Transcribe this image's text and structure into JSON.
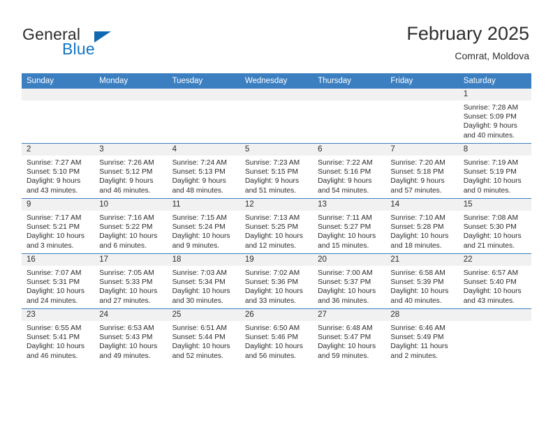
{
  "brand": {
    "word_one": "General",
    "word_two": "Blue",
    "accent_color": "#1275c4",
    "triangle_color": "#1269b0"
  },
  "header": {
    "title": "February 2025",
    "location": "Comrat, Moldova"
  },
  "theme": {
    "header_row_bg": "#3c7fc1",
    "daynum_band_bg": "#f1f1f1",
    "grid_line": "#3c7fc1"
  },
  "calendar": {
    "weekday_headers": [
      "Sunday",
      "Monday",
      "Tuesday",
      "Wednesday",
      "Thursday",
      "Friday",
      "Saturday"
    ],
    "weeks": [
      [
        {
          "day": "",
          "sunrise": "",
          "sunset": "",
          "daylight_line1": "",
          "daylight_line2": ""
        },
        {
          "day": "",
          "sunrise": "",
          "sunset": "",
          "daylight_line1": "",
          "daylight_line2": ""
        },
        {
          "day": "",
          "sunrise": "",
          "sunset": "",
          "daylight_line1": "",
          "daylight_line2": ""
        },
        {
          "day": "",
          "sunrise": "",
          "sunset": "",
          "daylight_line1": "",
          "daylight_line2": ""
        },
        {
          "day": "",
          "sunrise": "",
          "sunset": "",
          "daylight_line1": "",
          "daylight_line2": ""
        },
        {
          "day": "",
          "sunrise": "",
          "sunset": "",
          "daylight_line1": "",
          "daylight_line2": ""
        },
        {
          "day": "1",
          "sunrise": "Sunrise: 7:28 AM",
          "sunset": "Sunset: 5:09 PM",
          "daylight_line1": "Daylight: 9 hours",
          "daylight_line2": "and 40 minutes."
        }
      ],
      [
        {
          "day": "2",
          "sunrise": "Sunrise: 7:27 AM",
          "sunset": "Sunset: 5:10 PM",
          "daylight_line1": "Daylight: 9 hours",
          "daylight_line2": "and 43 minutes."
        },
        {
          "day": "3",
          "sunrise": "Sunrise: 7:26 AM",
          "sunset": "Sunset: 5:12 PM",
          "daylight_line1": "Daylight: 9 hours",
          "daylight_line2": "and 46 minutes."
        },
        {
          "day": "4",
          "sunrise": "Sunrise: 7:24 AM",
          "sunset": "Sunset: 5:13 PM",
          "daylight_line1": "Daylight: 9 hours",
          "daylight_line2": "and 48 minutes."
        },
        {
          "day": "5",
          "sunrise": "Sunrise: 7:23 AM",
          "sunset": "Sunset: 5:15 PM",
          "daylight_line1": "Daylight: 9 hours",
          "daylight_line2": "and 51 minutes."
        },
        {
          "day": "6",
          "sunrise": "Sunrise: 7:22 AM",
          "sunset": "Sunset: 5:16 PM",
          "daylight_line1": "Daylight: 9 hours",
          "daylight_line2": "and 54 minutes."
        },
        {
          "day": "7",
          "sunrise": "Sunrise: 7:20 AM",
          "sunset": "Sunset: 5:18 PM",
          "daylight_line1": "Daylight: 9 hours",
          "daylight_line2": "and 57 minutes."
        },
        {
          "day": "8",
          "sunrise": "Sunrise: 7:19 AM",
          "sunset": "Sunset: 5:19 PM",
          "daylight_line1": "Daylight: 10 hours",
          "daylight_line2": "and 0 minutes."
        }
      ],
      [
        {
          "day": "9",
          "sunrise": "Sunrise: 7:17 AM",
          "sunset": "Sunset: 5:21 PM",
          "daylight_line1": "Daylight: 10 hours",
          "daylight_line2": "and 3 minutes."
        },
        {
          "day": "10",
          "sunrise": "Sunrise: 7:16 AM",
          "sunset": "Sunset: 5:22 PM",
          "daylight_line1": "Daylight: 10 hours",
          "daylight_line2": "and 6 minutes."
        },
        {
          "day": "11",
          "sunrise": "Sunrise: 7:15 AM",
          "sunset": "Sunset: 5:24 PM",
          "daylight_line1": "Daylight: 10 hours",
          "daylight_line2": "and 9 minutes."
        },
        {
          "day": "12",
          "sunrise": "Sunrise: 7:13 AM",
          "sunset": "Sunset: 5:25 PM",
          "daylight_line1": "Daylight: 10 hours",
          "daylight_line2": "and 12 minutes."
        },
        {
          "day": "13",
          "sunrise": "Sunrise: 7:11 AM",
          "sunset": "Sunset: 5:27 PM",
          "daylight_line1": "Daylight: 10 hours",
          "daylight_line2": "and 15 minutes."
        },
        {
          "day": "14",
          "sunrise": "Sunrise: 7:10 AM",
          "sunset": "Sunset: 5:28 PM",
          "daylight_line1": "Daylight: 10 hours",
          "daylight_line2": "and 18 minutes."
        },
        {
          "day": "15",
          "sunrise": "Sunrise: 7:08 AM",
          "sunset": "Sunset: 5:30 PM",
          "daylight_line1": "Daylight: 10 hours",
          "daylight_line2": "and 21 minutes."
        }
      ],
      [
        {
          "day": "16",
          "sunrise": "Sunrise: 7:07 AM",
          "sunset": "Sunset: 5:31 PM",
          "daylight_line1": "Daylight: 10 hours",
          "daylight_line2": "and 24 minutes."
        },
        {
          "day": "17",
          "sunrise": "Sunrise: 7:05 AM",
          "sunset": "Sunset: 5:33 PM",
          "daylight_line1": "Daylight: 10 hours",
          "daylight_line2": "and 27 minutes."
        },
        {
          "day": "18",
          "sunrise": "Sunrise: 7:03 AM",
          "sunset": "Sunset: 5:34 PM",
          "daylight_line1": "Daylight: 10 hours",
          "daylight_line2": "and 30 minutes."
        },
        {
          "day": "19",
          "sunrise": "Sunrise: 7:02 AM",
          "sunset": "Sunset: 5:36 PM",
          "daylight_line1": "Daylight: 10 hours",
          "daylight_line2": "and 33 minutes."
        },
        {
          "day": "20",
          "sunrise": "Sunrise: 7:00 AM",
          "sunset": "Sunset: 5:37 PM",
          "daylight_line1": "Daylight: 10 hours",
          "daylight_line2": "and 36 minutes."
        },
        {
          "day": "21",
          "sunrise": "Sunrise: 6:58 AM",
          "sunset": "Sunset: 5:39 PM",
          "daylight_line1": "Daylight: 10 hours",
          "daylight_line2": "and 40 minutes."
        },
        {
          "day": "22",
          "sunrise": "Sunrise: 6:57 AM",
          "sunset": "Sunset: 5:40 PM",
          "daylight_line1": "Daylight: 10 hours",
          "daylight_line2": "and 43 minutes."
        }
      ],
      [
        {
          "day": "23",
          "sunrise": "Sunrise: 6:55 AM",
          "sunset": "Sunset: 5:41 PM",
          "daylight_line1": "Daylight: 10 hours",
          "daylight_line2": "and 46 minutes."
        },
        {
          "day": "24",
          "sunrise": "Sunrise: 6:53 AM",
          "sunset": "Sunset: 5:43 PM",
          "daylight_line1": "Daylight: 10 hours",
          "daylight_line2": "and 49 minutes."
        },
        {
          "day": "25",
          "sunrise": "Sunrise: 6:51 AM",
          "sunset": "Sunset: 5:44 PM",
          "daylight_line1": "Daylight: 10 hours",
          "daylight_line2": "and 52 minutes."
        },
        {
          "day": "26",
          "sunrise": "Sunrise: 6:50 AM",
          "sunset": "Sunset: 5:46 PM",
          "daylight_line1": "Daylight: 10 hours",
          "daylight_line2": "and 56 minutes."
        },
        {
          "day": "27",
          "sunrise": "Sunrise: 6:48 AM",
          "sunset": "Sunset: 5:47 PM",
          "daylight_line1": "Daylight: 10 hours",
          "daylight_line2": "and 59 minutes."
        },
        {
          "day": "28",
          "sunrise": "Sunrise: 6:46 AM",
          "sunset": "Sunset: 5:49 PM",
          "daylight_line1": "Daylight: 11 hours",
          "daylight_line2": "and 2 minutes."
        },
        {
          "day": "",
          "sunrise": "",
          "sunset": "",
          "daylight_line1": "",
          "daylight_line2": ""
        }
      ]
    ]
  }
}
